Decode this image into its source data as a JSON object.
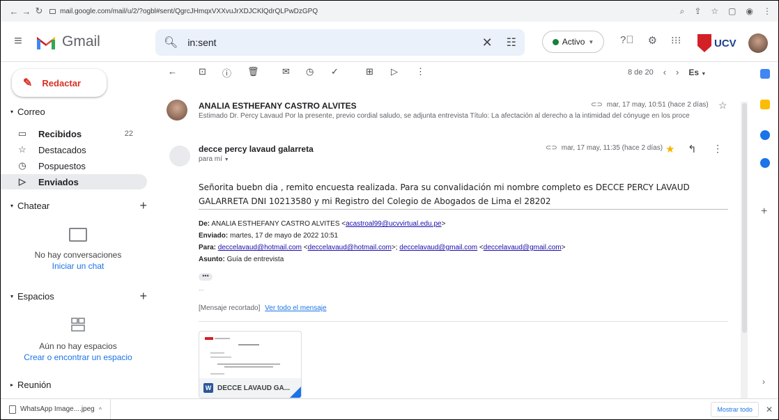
{
  "browser": {
    "url": "mail.google.com/mail/u/2/?ogbl#sent/QgrcJHmqxVXXvuJrXDJCKlQdrQLPwDzGPQ"
  },
  "header": {
    "app_name": "Gmail",
    "search_value": "in:sent",
    "status_label": "Activo",
    "org_logo_text": "UCV"
  },
  "sidebar": {
    "compose_label": "Redactar",
    "mail_section": "Correo",
    "items": [
      {
        "label": "Recibidos",
        "count": "22",
        "icon": "inbox-icon"
      },
      {
        "label": "Destacados",
        "count": "",
        "icon": "star-icon"
      },
      {
        "label": "Pospuestos",
        "count": "",
        "icon": "clock-icon"
      },
      {
        "label": "Enviados",
        "count": "",
        "icon": "send-icon"
      }
    ],
    "chat_section": "Chatear",
    "chat_empty": "No hay conversaciones",
    "chat_link": "Iniciar un chat",
    "spaces_section": "Espacios",
    "spaces_empty": "Aún no hay espacios",
    "spaces_link": "Crear o encontrar un espacio",
    "meet_section": "Reunión"
  },
  "toolbar": {
    "pager": "8 de 20",
    "lang": "Es"
  },
  "thread": {
    "msg1": {
      "sender": "ANALIA ESTHEFANY CASTRO ALVITES",
      "snippet": "Estimado Dr. Percy Lavaud Por la presente, previo cordial saludo, se adjunta entrevista Título: La afectación al derecho a la intimidad del cónyuge en los proce",
      "date": "mar, 17 may, 10:51 (hace 2 días)"
    },
    "msg2": {
      "sender": "decce percy lavaud galarreta",
      "to": "para mí",
      "date": "mar, 17 may, 11:35 (hace 2 días)",
      "body": "Señorita buebn dia , remito encuesta  realizada. Para su convalidación mi nombre completo es DECCE PERCY LAVAUD GALARRETA  DNI 10213580 y mi Registro del Colegio de Abogados de Lima el 28202",
      "de_label": "De:",
      "de_name": "ANALIA ESTHEFANY CASTRO ALVITES <",
      "de_email": "acastroal99@ucvvirtual.edu.pe",
      "de_close": ">",
      "enviado_label": "Enviado:",
      "enviado_value": "martes, 17 de mayo de 2022 10:51",
      "para_label": "Para:",
      "para_1": "deccelavaud@hotmail.com",
      "para_2": "deccelavaud@hotmail.com",
      "para_3": "deccelavaud@gmail.com",
      "para_4": "deccelavaud@gmail.com",
      "asunto_label": "Asunto:",
      "asunto_value": "Guía de entrevista",
      "ellipsis": "•••",
      "tiny": "...",
      "clipped": "[Mensaje recortado]",
      "view_all": "Ver todo el mensaje",
      "attachment": "DECCE LAVAUD GA..."
    }
  },
  "downloads": {
    "file": "WhatsApp Image....jpeg",
    "show_all": "Mostrar todo"
  }
}
